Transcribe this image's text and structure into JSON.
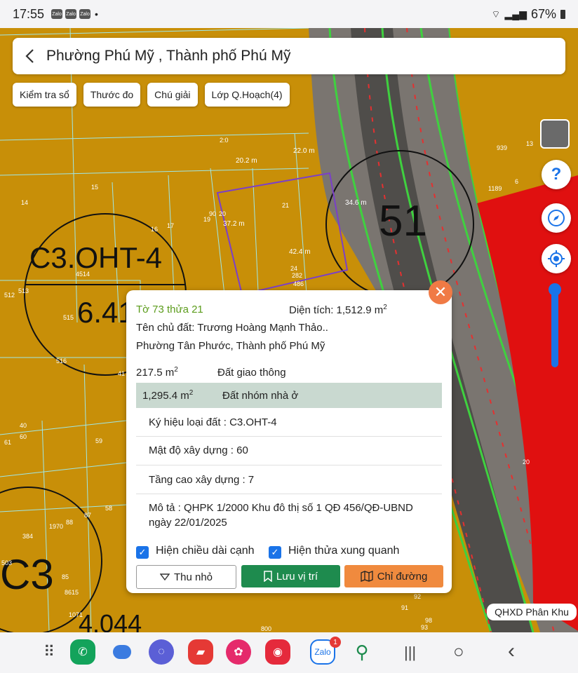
{
  "status": {
    "time": "17:55",
    "notif_icons": [
      "Zalo",
      "Zalo",
      "Zalo"
    ],
    "dot": "•",
    "battery": "67%"
  },
  "header": {
    "back_icon": "chevron-left-icon",
    "title": "Phường Phú Mỹ , Thành phố Phú Mỹ"
  },
  "toolbar": {
    "chips": [
      "Kiểm tra sổ",
      "Thước đo",
      "Chú giải",
      "Lớp Q.Hoạch(4)"
    ]
  },
  "map": {
    "zone_label": "C3.OHT-4",
    "zone_value": "6.41",
    "zone_label_2": "C3",
    "zone_value_2": "4.044",
    "block_number": "51",
    "parcel_numbers": [
      "2:0",
      "15",
      "14",
      "16",
      "17",
      "19",
      "90",
      "20",
      "21",
      "4514",
      "513",
      "512",
      "515",
      "516",
      "24",
      "282",
      "486",
      "939",
      "13",
      "1189",
      "6",
      "40",
      "60",
      "61",
      "59",
      "58",
      "87",
      "88",
      "1970",
      "384",
      "503",
      "85",
      "8615",
      "1071",
      "800",
      "20",
      "92",
      "91",
      "93",
      "98",
      "41"
    ],
    "edge_lengths": [
      "20.2 m",
      "22.0 m",
      "34.6 m",
      "37.2 m",
      "42.4 m"
    ]
  },
  "controls": {
    "help_icon": "question-icon",
    "compass_icon": "compass-icon",
    "locate_icon": "locate-icon",
    "layer_icon": "satellite-layer-icon"
  },
  "popup": {
    "parcel": "Tờ 73 thửa 21",
    "area_label": "Diện tích: 1,512.9 m",
    "area_sup": "2",
    "owner": "Tên chủ đất: Trương Hoàng Mạnh Thảo..",
    "address": "Phường Tân Phước, Thành phố Phú Mỹ",
    "uses": [
      {
        "area": "217.5 m",
        "sup": "2",
        "type": "Đất giao thông"
      },
      {
        "area": "1,295.4 m",
        "sup": "2",
        "type": "Đất nhóm nhà ở"
      }
    ],
    "land_code": "Ký hiệu loại đất : C3.OHT-4",
    "density": "Mật độ xây dựng : 60",
    "floors": "Tầng cao xây dựng : 7",
    "desc_line1": "Mô tả : QHPK 1/2000 Khu đô thị số 1 QĐ 456/QĐ-UBND",
    "desc_line2": "ngày 22/01/2025",
    "checkbox_edges": "Hiện chiều dài cạnh",
    "checkbox_neighbors": "Hiện thửa xung quanh",
    "btn_shrink": "Thu nhỏ",
    "btn_save": "Lưu vị trí",
    "btn_directions": "Chỉ đường",
    "close_icon": "close-icon"
  },
  "map_badge": "QHXD Phân Khu",
  "dock": {
    "apps": [
      "apps-grid-icon",
      "phone-icon",
      "messages-icon",
      "browser-icon",
      "notes-icon",
      "gallery-icon",
      "camera-icon",
      "zalo-icon",
      "map-app-icon"
    ],
    "zalo_label": "Zalo",
    "zalo_badge": "1",
    "recents": "|||",
    "home": "○",
    "back": "‹"
  },
  "colors": {
    "zone": "#c88f08",
    "red_zone": "#e01010",
    "accent_green": "#1e8b4e",
    "accent_orange": "#f08a3e",
    "checkbox": "#1a73e8"
  }
}
